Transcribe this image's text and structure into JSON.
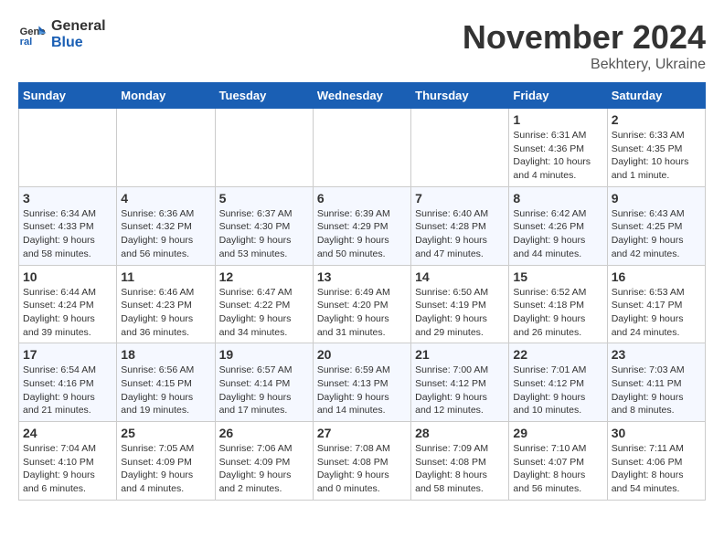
{
  "logo": {
    "line1": "General",
    "line2": "Blue"
  },
  "title": "November 2024",
  "location": "Bekhtery, Ukraine",
  "weekdays": [
    "Sunday",
    "Monday",
    "Tuesday",
    "Wednesday",
    "Thursday",
    "Friday",
    "Saturday"
  ],
  "weeks": [
    [
      {
        "day": "",
        "info": ""
      },
      {
        "day": "",
        "info": ""
      },
      {
        "day": "",
        "info": ""
      },
      {
        "day": "",
        "info": ""
      },
      {
        "day": "",
        "info": ""
      },
      {
        "day": "1",
        "info": "Sunrise: 6:31 AM\nSunset: 4:36 PM\nDaylight: 10 hours\nand 4 minutes."
      },
      {
        "day": "2",
        "info": "Sunrise: 6:33 AM\nSunset: 4:35 PM\nDaylight: 10 hours\nand 1 minute."
      }
    ],
    [
      {
        "day": "3",
        "info": "Sunrise: 6:34 AM\nSunset: 4:33 PM\nDaylight: 9 hours\nand 58 minutes."
      },
      {
        "day": "4",
        "info": "Sunrise: 6:36 AM\nSunset: 4:32 PM\nDaylight: 9 hours\nand 56 minutes."
      },
      {
        "day": "5",
        "info": "Sunrise: 6:37 AM\nSunset: 4:30 PM\nDaylight: 9 hours\nand 53 minutes."
      },
      {
        "day": "6",
        "info": "Sunrise: 6:39 AM\nSunset: 4:29 PM\nDaylight: 9 hours\nand 50 minutes."
      },
      {
        "day": "7",
        "info": "Sunrise: 6:40 AM\nSunset: 4:28 PM\nDaylight: 9 hours\nand 47 minutes."
      },
      {
        "day": "8",
        "info": "Sunrise: 6:42 AM\nSunset: 4:26 PM\nDaylight: 9 hours\nand 44 minutes."
      },
      {
        "day": "9",
        "info": "Sunrise: 6:43 AM\nSunset: 4:25 PM\nDaylight: 9 hours\nand 42 minutes."
      }
    ],
    [
      {
        "day": "10",
        "info": "Sunrise: 6:44 AM\nSunset: 4:24 PM\nDaylight: 9 hours\nand 39 minutes."
      },
      {
        "day": "11",
        "info": "Sunrise: 6:46 AM\nSunset: 4:23 PM\nDaylight: 9 hours\nand 36 minutes."
      },
      {
        "day": "12",
        "info": "Sunrise: 6:47 AM\nSunset: 4:22 PM\nDaylight: 9 hours\nand 34 minutes."
      },
      {
        "day": "13",
        "info": "Sunrise: 6:49 AM\nSunset: 4:20 PM\nDaylight: 9 hours\nand 31 minutes."
      },
      {
        "day": "14",
        "info": "Sunrise: 6:50 AM\nSunset: 4:19 PM\nDaylight: 9 hours\nand 29 minutes."
      },
      {
        "day": "15",
        "info": "Sunrise: 6:52 AM\nSunset: 4:18 PM\nDaylight: 9 hours\nand 26 minutes."
      },
      {
        "day": "16",
        "info": "Sunrise: 6:53 AM\nSunset: 4:17 PM\nDaylight: 9 hours\nand 24 minutes."
      }
    ],
    [
      {
        "day": "17",
        "info": "Sunrise: 6:54 AM\nSunset: 4:16 PM\nDaylight: 9 hours\nand 21 minutes."
      },
      {
        "day": "18",
        "info": "Sunrise: 6:56 AM\nSunset: 4:15 PM\nDaylight: 9 hours\nand 19 minutes."
      },
      {
        "day": "19",
        "info": "Sunrise: 6:57 AM\nSunset: 4:14 PM\nDaylight: 9 hours\nand 17 minutes."
      },
      {
        "day": "20",
        "info": "Sunrise: 6:59 AM\nSunset: 4:13 PM\nDaylight: 9 hours\nand 14 minutes."
      },
      {
        "day": "21",
        "info": "Sunrise: 7:00 AM\nSunset: 4:12 PM\nDaylight: 9 hours\nand 12 minutes."
      },
      {
        "day": "22",
        "info": "Sunrise: 7:01 AM\nSunset: 4:12 PM\nDaylight: 9 hours\nand 10 minutes."
      },
      {
        "day": "23",
        "info": "Sunrise: 7:03 AM\nSunset: 4:11 PM\nDaylight: 9 hours\nand 8 minutes."
      }
    ],
    [
      {
        "day": "24",
        "info": "Sunrise: 7:04 AM\nSunset: 4:10 PM\nDaylight: 9 hours\nand 6 minutes."
      },
      {
        "day": "25",
        "info": "Sunrise: 7:05 AM\nSunset: 4:09 PM\nDaylight: 9 hours\nand 4 minutes."
      },
      {
        "day": "26",
        "info": "Sunrise: 7:06 AM\nSunset: 4:09 PM\nDaylight: 9 hours\nand 2 minutes."
      },
      {
        "day": "27",
        "info": "Sunrise: 7:08 AM\nSunset: 4:08 PM\nDaylight: 9 hours\nand 0 minutes."
      },
      {
        "day": "28",
        "info": "Sunrise: 7:09 AM\nSunset: 4:08 PM\nDaylight: 8 hours\nand 58 minutes."
      },
      {
        "day": "29",
        "info": "Sunrise: 7:10 AM\nSunset: 4:07 PM\nDaylight: 8 hours\nand 56 minutes."
      },
      {
        "day": "30",
        "info": "Sunrise: 7:11 AM\nSunset: 4:06 PM\nDaylight: 8 hours\nand 54 minutes."
      }
    ]
  ]
}
